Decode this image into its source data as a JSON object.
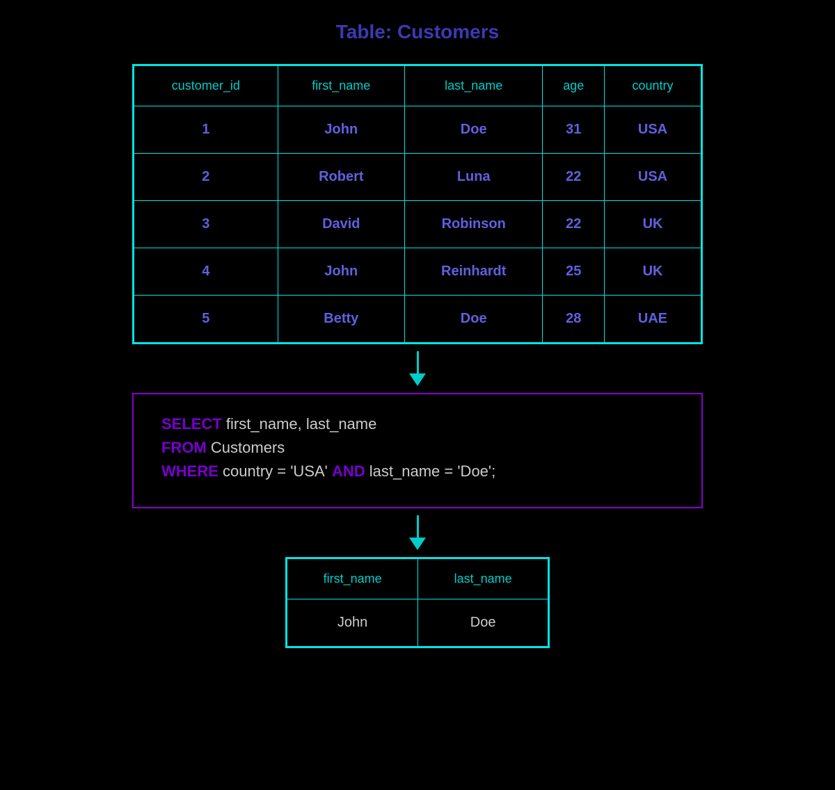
{
  "page": {
    "title": "Table: Customers",
    "background": "#000000"
  },
  "customers_table": {
    "headers": [
      "customer_id",
      "first_name",
      "last_name",
      "age",
      "country"
    ],
    "rows": [
      [
        "1",
        "John",
        "Doe",
        "31",
        "USA"
      ],
      [
        "2",
        "Robert",
        "Luna",
        "22",
        "USA"
      ],
      [
        "3",
        "David",
        "Robinson",
        "22",
        "UK"
      ],
      [
        "4",
        "John",
        "Reinhardt",
        "25",
        "UK"
      ],
      [
        "5",
        "Betty",
        "Doe",
        "28",
        "UAE"
      ]
    ]
  },
  "sql_query": {
    "line1_keyword": "SELECT",
    "line1_text": " first_name, last_name",
    "line2_keyword": "FROM",
    "line2_text": " Customers",
    "line3_keyword": "WHERE",
    "line3_text": " country = ‘USA’ ",
    "line3_and": "AND",
    "line3_text2": " last_name = ‘Doe’;"
  },
  "result_table": {
    "headers": [
      "first_name",
      "last_name"
    ],
    "rows": [
      [
        "John",
        "Doe"
      ]
    ]
  }
}
